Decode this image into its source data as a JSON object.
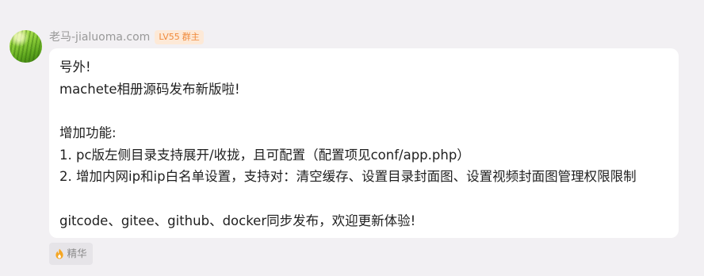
{
  "message": {
    "sender_name": "老马-jialuoma.com",
    "badge": {
      "level": "LV55",
      "role": "群主"
    },
    "lines": [
      "号外!",
      "machete相册源码发布新版啦!",
      "",
      "增加功能:",
      "1. pc版左侧目录支持展开/收拢，且可配置（配置项见conf/app.php）",
      "2. 增加内网ip和ip白名单设置，支持对：清空缓存、设置目录封面图、设置视频封面图管理权限限制",
      "",
      "gitcode、gitee、github、docker同步发布，欢迎更新体验!"
    ],
    "tag": {
      "label": "精华",
      "icon": "flame-icon"
    }
  },
  "colors": {
    "background": "#f2f0f3",
    "bubble": "#ffffff",
    "badge_bg": "#fde9d7",
    "badge_text": "#f08a3c",
    "flame": "#f5a623"
  }
}
